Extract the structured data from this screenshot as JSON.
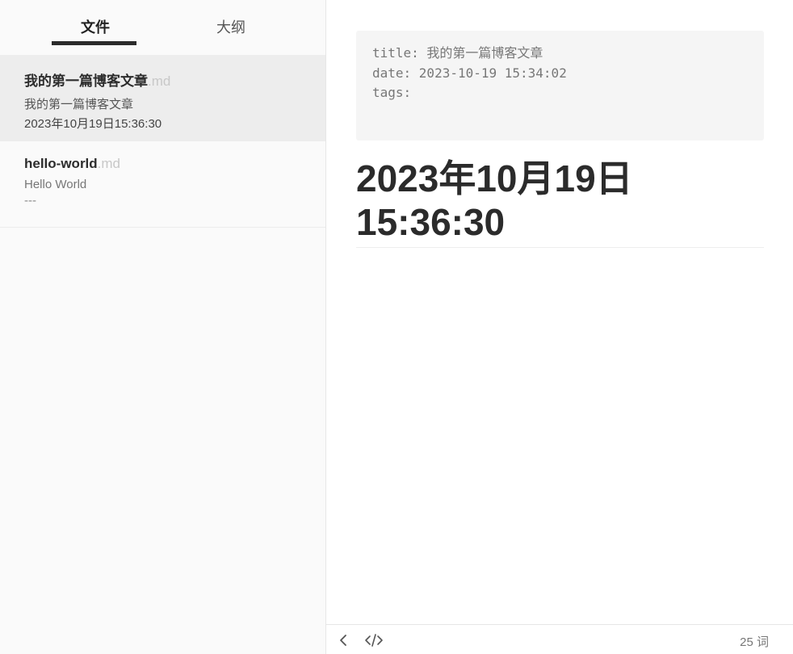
{
  "sidebar": {
    "tabs": [
      {
        "label": "文件",
        "active": true
      },
      {
        "label": "大纲",
        "active": false
      }
    ],
    "files": [
      {
        "name": "我的第一篇博客文章",
        "ext": ".md",
        "summary": "我的第一篇博客文章",
        "date": "2023年10月19日15:36:30",
        "active": true
      },
      {
        "name": "hello-world",
        "ext": ".md",
        "summary": "Hello World",
        "date": "---",
        "active": false
      }
    ]
  },
  "editor": {
    "front_matter": {
      "title_line": "title: 我的第一篇博客文章",
      "date_line": "date: 2023-10-19 15:34:02",
      "tags_line": "tags:"
    },
    "heading": {
      "line1": "2023年10月19日",
      "line2": "15:36:30"
    }
  },
  "status_bar": {
    "back_icon": "chevron-left-icon",
    "source_icon": "code-icon",
    "word_count": "25 词"
  }
}
